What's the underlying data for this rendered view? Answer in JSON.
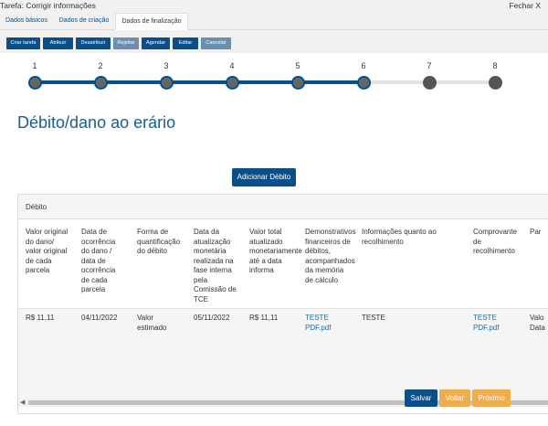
{
  "window": {
    "title": "Tarefa: Corrigir informações",
    "close_label": "Fechar X"
  },
  "tabs": [
    {
      "label": "Dados básicos",
      "active": false
    },
    {
      "label": "Dados de criação",
      "active": false
    },
    {
      "label": "Dados de finalização",
      "active": true
    }
  ],
  "toolbar": {
    "criar_tarefa": "Criar tarefa",
    "atribuir": "Atribuir",
    "desatribuir": "Desatribuir",
    "rejeitar": "Rejeitar",
    "agendar": "Agendar",
    "editar": "Editar",
    "cancelar": "Cancelar"
  },
  "stepper": {
    "steps": [
      "1",
      "2",
      "3",
      "4",
      "5",
      "6",
      "7",
      "8"
    ],
    "current": 6,
    "colors": {
      "done_line": "#0b4f8a",
      "todo_line": "#e3e3e3",
      "dot": "#666666"
    }
  },
  "heading": "Débito/dano ao erário",
  "add_button": "Adicionar Débito",
  "table": {
    "title": "Débito",
    "columns": [
      "Valor original do dano/ valor original de cada parcela",
      "Data de ocorrência do dano / data de ocorrência de cada parcela",
      "Forma de quantificação do débito",
      "Data da atualização monetária realizada na fase interna pela Comissão de TCE",
      "Valor total atualizado monetariamente até a data informa",
      "Demonstrativos financeiros de débitos, acompanhados da memória de cálculo",
      "Informações quanto ao recolhimento",
      "Comprovante de recolhimento",
      "Par"
    ],
    "row": {
      "valor": "R$ 11,11",
      "data_ocorrencia": "04/11/2022",
      "forma": "Valor estimado",
      "data_atualizacao": "05/11/2022",
      "valor_total": "R$ 11,11",
      "demonstrativo": "TESTE PDF.pdf",
      "informacoes": "TESTE",
      "comprovante": "TESTE PDF.pdf",
      "parcial": "Valo Data"
    }
  },
  "footer": {
    "save": "Salvar",
    "back": "Voltar",
    "next": "Próximo"
  }
}
